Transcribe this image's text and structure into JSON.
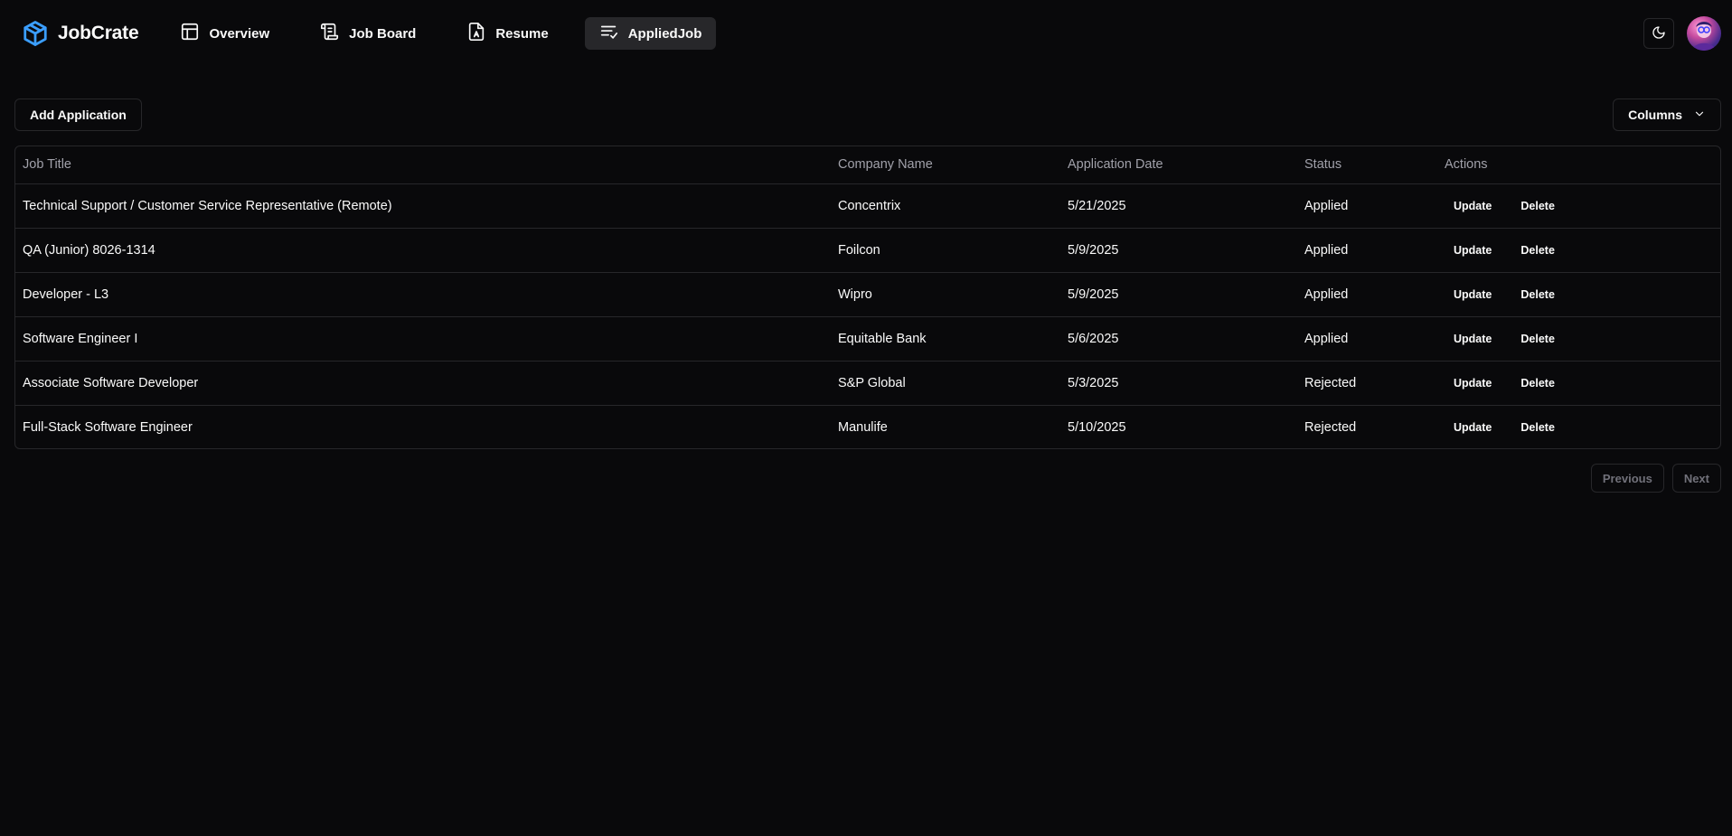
{
  "nav": {
    "brand": "JobCrate",
    "items": [
      {
        "label": "Overview",
        "icon": "layout-panel-icon",
        "active": false
      },
      {
        "label": "Job Board",
        "icon": "scroll-icon",
        "active": false
      },
      {
        "label": "Resume",
        "icon": "file-type-icon",
        "active": false
      },
      {
        "label": "AppliedJob",
        "icon": "list-check-icon",
        "active": true
      }
    ],
    "theme_icon": "moon-icon",
    "avatar_icon": "user-avatar"
  },
  "toolbar": {
    "add_label": "Add Application",
    "columns_label": "Columns"
  },
  "table": {
    "headers": [
      "Job Title",
      "Company Name",
      "Application Date",
      "Status",
      "Actions"
    ],
    "rows": [
      {
        "title": "Technical Support / Customer Service Representative (Remote)",
        "company": "Concentrix",
        "date": "5/21/2025",
        "status": "Applied"
      },
      {
        "title": "QA (Junior) 8026-1314",
        "company": "Foilcon",
        "date": "5/9/2025",
        "status": "Applied"
      },
      {
        "title": "Developer - L3",
        "company": "Wipro",
        "date": "5/9/2025",
        "status": "Applied"
      },
      {
        "title": "Software Engineer I",
        "company": "Equitable Bank",
        "date": "5/6/2025",
        "status": "Applied"
      },
      {
        "title": "Associate Software Developer",
        "company": "S&P Global",
        "date": "5/3/2025",
        "status": "Rejected"
      },
      {
        "title": "Full-Stack Software Engineer",
        "company": "Manulife",
        "date": "5/10/2025",
        "status": "Rejected"
      }
    ],
    "update_label": "Update",
    "delete_label": "Delete"
  },
  "pagination": {
    "previous_label": "Previous",
    "next_label": "Next"
  },
  "colors": {
    "background": "#09090b",
    "accent": "#3b9eff",
    "border": "#27272a",
    "muted": "#a1a1aa"
  }
}
